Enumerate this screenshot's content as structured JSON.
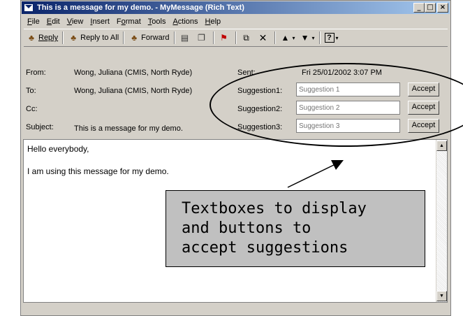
{
  "window": {
    "title": "This is a message for my demo. - MyMessage (Rich Text)",
    "controls": {
      "minimize": "_",
      "maximize": "□",
      "close": "×"
    }
  },
  "menu": [
    {
      "pre": "",
      "u": "F",
      "post": "ile"
    },
    {
      "pre": "",
      "u": "E",
      "post": "dit"
    },
    {
      "pre": "",
      "u": "V",
      "post": "iew"
    },
    {
      "pre": "",
      "u": "I",
      "post": "nsert"
    },
    {
      "pre": "F",
      "u": "o",
      "post": "rmat"
    },
    {
      "pre": "",
      "u": "T",
      "post": "ools"
    },
    {
      "pre": "",
      "u": "A",
      "post": "ctions"
    },
    {
      "pre": "",
      "u": "H",
      "post": "elp"
    }
  ],
  "toolbar": {
    "reply": "Reply",
    "reply_all": "Reply to All",
    "forward": "Forward",
    "icons": [
      "people-icon",
      "print-icon",
      "copy-icon",
      "flag-icon",
      "move-icon",
      "delete-icon",
      "up-arrow-icon",
      "down-arrow-icon",
      "help-icon"
    ]
  },
  "header": {
    "from_label": "From:",
    "from_value": "Wong, Juliana (CMIS, North Ryde)",
    "to_label": "To:",
    "to_value": "Wong, Juliana (CMIS, North Ryde)",
    "cc_label": "Cc:",
    "subject_label": "Subject:",
    "subject_value": "This is a message for my demo.",
    "sent_label": "Sent:",
    "sent_value": "Fri 25/01/2002 3:07 PM"
  },
  "suggestions": [
    {
      "label": "Suggestion1:",
      "placeholder": "Suggestion 1",
      "button": "Accept"
    },
    {
      "label": "Suggestion2:",
      "placeholder": "Suggestion 2",
      "button": "Accept"
    },
    {
      "label": "Suggestion3:",
      "placeholder": "Suggestion 3",
      "button": "Accept"
    }
  ],
  "body": {
    "line1": "Hello everybody,",
    "line2": "I am using this message for my demo."
  },
  "annotation": {
    "line1": "Textboxes to display",
    "line2": "and buttons to",
    "line3": "accept suggestions"
  }
}
